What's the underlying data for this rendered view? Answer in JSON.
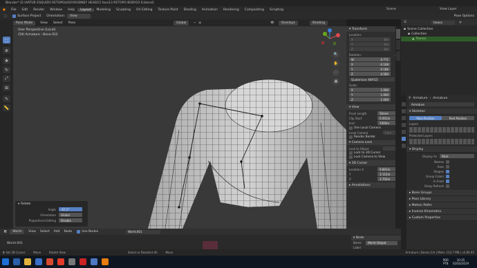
{
  "window_title": "Blender* [E:\\ARTUR ESQUIZO RETOPOLOGY\\RODNEY HEAD15 face13 RETOPO BODY22 6.blend]",
  "menu": [
    "File",
    "Edit",
    "Render",
    "Window",
    "Help"
  ],
  "workspaces": [
    "Layout",
    "Modeling",
    "Sculpting",
    "UV Editing",
    "Texture Paint",
    "Shading",
    "Animation",
    "Rendering",
    "Compositing",
    "Scripting"
  ],
  "scene_label": "Scene",
  "view_layer_label": "View Layer",
  "tool_header": {
    "surface_project": "Surface Project",
    "orientation_label": "Orientation:",
    "orientation_value": "View",
    "pose_options": "Pose Options"
  },
  "vp_header": {
    "mode": "Pose Mode",
    "menus": [
      "View",
      "Select",
      "Pose"
    ],
    "transform": "Global",
    "overlays": "Overlays",
    "shading": "Shading"
  },
  "viewport": {
    "view_name": "User Perspective (Local)",
    "object_info": "(59) Armature : Bone.012"
  },
  "npanel": {
    "transform_title": "Transform",
    "location_label": "Location:",
    "loc": [
      {
        "axis": "X",
        "value": "0m"
      },
      {
        "axis": "Y",
        "value": "0m"
      },
      {
        "axis": "Z",
        "value": "0m"
      }
    ],
    "rotation_label": "Rotation:",
    "rotation_mode": "4L",
    "rot": [
      {
        "axis": "W",
        "value": "0.771"
      },
      {
        "axis": "X",
        "value": "-0.168"
      },
      {
        "axis": "Y",
        "value": "0.186"
      },
      {
        "axis": "Z",
        "value": "0.580"
      }
    ],
    "rotation_type": "Quaternion (WXYZ)",
    "scale_label": "Scale:",
    "scale": [
      {
        "axis": "X",
        "value": "1.000"
      },
      {
        "axis": "Y",
        "value": "1.000"
      },
      {
        "axis": "Z",
        "value": "1.000"
      }
    ],
    "view_title": "View",
    "focal_length_label": "Focal Length",
    "focal_length": "50mm",
    "clip_start_label": "Clip Start",
    "clip_start": "0.001m",
    "end_label": "End",
    "end": "1000m",
    "use_local_camera": "Use Local Camera",
    "local_camera": "Local Camera",
    "camera_placeholder": "Cam",
    "render_border": "Render Border",
    "camera_lock": "Camera Lock",
    "lock_to_object": "Lock to Object",
    "lock_to_3d_cursor": "Lock to 3D Cursor",
    "lock_camera_to_view": "Lock Camera to View",
    "cursor_title": "3D Cursor",
    "cursor_location_label": "Location X",
    "cursor": [
      {
        "axis": "X",
        "value": "9.891m"
      },
      {
        "axis": "Y",
        "value": "3.112m"
      },
      {
        "axis": "Z",
        "value": "3.702m"
      }
    ],
    "annotations_title": "Annotations"
  },
  "npanel_tabs": [
    "Item",
    "Tool",
    "View"
  ],
  "outliner": {
    "search_placeholder": "tronco",
    "items": [
      "Scene Collection",
      "Collection",
      "Tronco"
    ]
  },
  "properties": {
    "breadcrumb_a": "Armature",
    "breadcrumb_b": "Armature",
    "data_name": "Armature",
    "skeleton_title": "Skeleton",
    "pose_position": "Pose Position",
    "rest_position": "Rest Position",
    "layers_title": "Layers",
    "protected_layers_title": "Protected Layers",
    "display_title": "Display",
    "display_as_label": "Display As",
    "display_as_value": "Stick",
    "toggles": [
      {
        "label": "Names",
        "on": false
      },
      {
        "label": "Axes",
        "on": false
      },
      {
        "label": "Shapes",
        "on": true
      },
      {
        "label": "Group Colors",
        "on": true
      },
      {
        "label": "In Front",
        "on": true
      },
      {
        "label": "Delay Refresh",
        "on": false
      }
    ],
    "collapsed": [
      "Bone Groups",
      "Pose Library",
      "Motion Paths",
      "Inverse Kinematics",
      "Custom Properties"
    ]
  },
  "last_operator": {
    "title": "Rotate",
    "angle_label": "Angle",
    "angle_value": "-67.2°",
    "orientation_label": "Orientation",
    "orientation_value": "Global",
    "prop_edit_label": "Proportional Editing",
    "prop_edit_value": "Disable"
  },
  "node_editor": {
    "editor": "World",
    "menus": [
      "View",
      "Select",
      "Add",
      "Node"
    ],
    "use_nodes": "Use Nodes",
    "world_name": "World.001",
    "breadcrumb": "World.001",
    "panel_title": "Node",
    "name_label": "Name",
    "name_value": "World Output",
    "label_label": "Label"
  },
  "status": {
    "left": [
      "Set 3D Cursor",
      "Move",
      "Rotate View"
    ],
    "center": [
      "Select or Deselect All",
      "Move"
    ],
    "right": "Armature | Bones:1/4 | Mem: 122.7 MB | v2.80.45"
  },
  "taskbar": {
    "lang": "POR",
    "kb": "PTB",
    "time": "10:35",
    "date": "02/03/2019"
  },
  "colors": {
    "accent": "#5680c2",
    "viewport_bg": "#393939",
    "mesh": "#c9c9c9",
    "wire": "#222222"
  }
}
